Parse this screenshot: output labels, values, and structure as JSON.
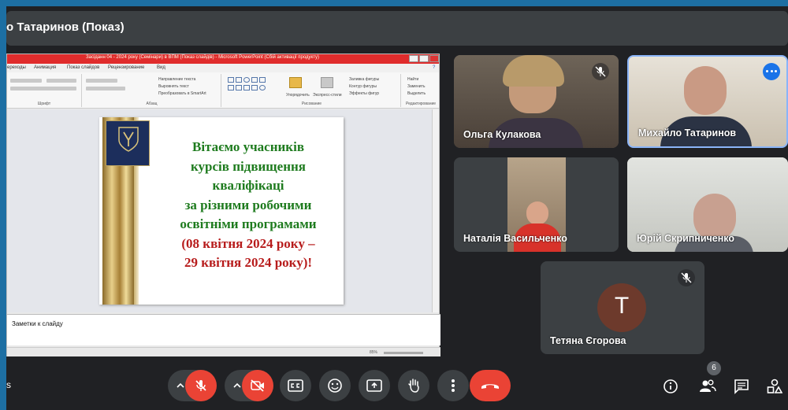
{
  "meeting": {
    "title": "о Татаринов (Показ)",
    "left_edge_text": "s",
    "participant_count": "6"
  },
  "powerpoint": {
    "window_title": "Засіданн 04 - 2024 року (Семінари) в ВПМ (Показ слайдів) - Microsoft PowerPoint (Сбій активації продукту)",
    "tabs": [
      "ереходы",
      "Анимация",
      "Показ слайдов",
      "Рецензирование",
      "Вид"
    ],
    "groups": [
      "Шрифт",
      "Абзац",
      "Рисование",
      "Редактирование"
    ],
    "ribbon_items": [
      "Направление текста",
      "Выровнять текст",
      "Преобразовать в SmartArt",
      "Упорядочить",
      "Экспресс-стили",
      "Заливка фигуры",
      "Контур фигуры",
      "Эффекты фигур",
      "Найти",
      "Заменить",
      "Выделить"
    ],
    "notes_placeholder": "Заметки к слайду",
    "zoom": "85%"
  },
  "slide": {
    "lines_green": [
      "Вітаємо учасників",
      "курсів підвищення",
      "кваліфікаці",
      "за різними робочими",
      "освітніми програмами"
    ],
    "lines_red": [
      "(08 квітня 2024 року –",
      "29 квітня 2024 року)!"
    ]
  },
  "participants": [
    {
      "name": "Ольга Кулакова",
      "muted": true
    },
    {
      "name": "Михайло Татаринов",
      "muted": false
    },
    {
      "name": "Наталія Васильченко",
      "muted": false
    },
    {
      "name": "Юрій Скрипниченко",
      "muted": false
    },
    {
      "name": "Тетяна Єгорова",
      "muted": true,
      "initial": "Т",
      "avatar_color": "#6d3a2c"
    }
  ],
  "colors": {
    "accent": "#1a73e8",
    "danger": "#ea4335",
    "control_bg": "#3c4043",
    "background": "#202124"
  },
  "icons": {
    "mic": "mic-off-icon",
    "camera": "camera-off-icon",
    "captions": "captions-icon",
    "emoji": "emoji-icon",
    "present": "present-screen-icon",
    "hand": "raise-hand-icon",
    "more": "more-vert-icon",
    "end": "end-call-icon",
    "info": "info-icon",
    "people": "people-icon",
    "chat": "chat-icon",
    "activities": "activities-icon"
  }
}
